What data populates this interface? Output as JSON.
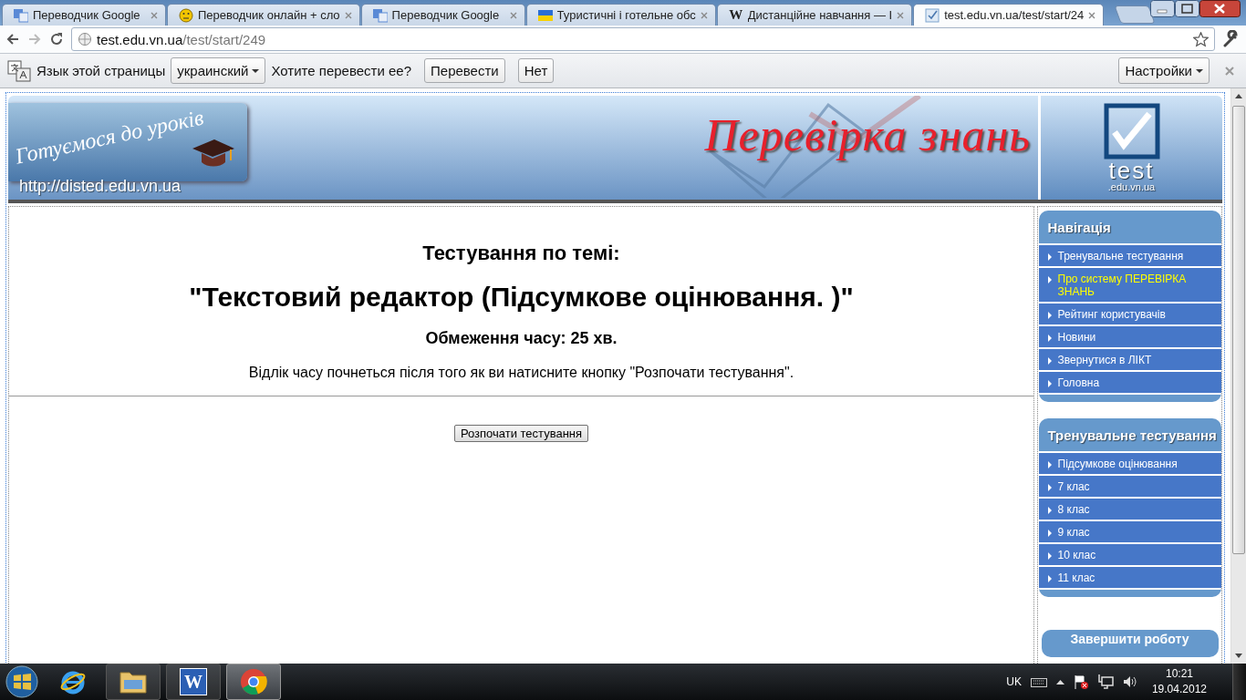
{
  "browser": {
    "tabs": [
      {
        "title": "Переводчик Google",
        "kind": "translate",
        "selected": false
      },
      {
        "title": "Переводчик онлайн + сло",
        "kind": "smiley",
        "selected": false
      },
      {
        "title": "Переводчик Google",
        "kind": "translate",
        "selected": false
      },
      {
        "title": "Туристичні і готельне обс",
        "kind": "flag",
        "selected": false
      },
      {
        "title": "Дистанційне навчання — І",
        "kind": "wiki",
        "glyph": "W",
        "selected": false
      },
      {
        "title": "test.edu.vn.ua/test/start/24",
        "kind": "check",
        "selected": true
      }
    ],
    "url_host": "test.edu.vn.ua",
    "url_path": "/test/start/249"
  },
  "translate_bar": {
    "label": "Язык этой страницы",
    "language": "украинский",
    "question": "Хотите перевести ее?",
    "buttons": [
      "Перевести",
      "Нет"
    ],
    "options": "Настройки"
  },
  "banner": {
    "motto": "Готуємося до уроків",
    "site": "http://disted.edu.vn.ua",
    "title": "Перевірка знань",
    "logo_word": "test",
    "logo_domain": ".edu.vn.ua"
  },
  "main": {
    "heading": "Тестування по темі:",
    "topic": "\"Текстовий редактор (Підсумкове оцінювання. )\"",
    "time_limit": "Обмеження часу: 25 хв.",
    "note": "Відлік часу почнеться після того як ви натисните кнопку \"Розпочати тестування\".",
    "start_button": "Розпочати тестування"
  },
  "sidebar": {
    "panels": [
      {
        "title": "Навігація",
        "items": [
          {
            "label": "Тренувальне тестування",
            "highlighted": false
          },
          {
            "label": "Про систему ПЕРЕВІРКА ЗНАНЬ",
            "highlighted": true
          },
          {
            "label": "Рейтинг користувачів",
            "highlighted": false
          },
          {
            "label": "Новини",
            "highlighted": false
          },
          {
            "label": "Звернутися в ЛІКТ",
            "highlighted": false
          },
          {
            "label": "Головна",
            "highlighted": false
          }
        ]
      },
      {
        "title": "Тренувальне тестування",
        "items": [
          {
            "label": "Підсумкове оцінювання",
            "highlighted": false
          },
          {
            "label": "7 клас",
            "highlighted": false
          },
          {
            "label": "8 клас",
            "highlighted": false
          },
          {
            "label": "9 клас",
            "highlighted": false
          },
          {
            "label": "10 клас",
            "highlighted": false
          },
          {
            "label": "11 клас",
            "highlighted": false
          }
        ]
      }
    ],
    "finish_button": "Завершити роботу"
  },
  "taskbar": {
    "apps": [
      {
        "kind": "ie",
        "active": false
      },
      {
        "kind": "explorer",
        "active": false
      },
      {
        "kind": "word",
        "glyph": "W",
        "active": false
      },
      {
        "kind": "chrome",
        "active": true
      }
    ],
    "language": "UK",
    "time": "10:21",
    "date": "19.04.2012"
  }
}
